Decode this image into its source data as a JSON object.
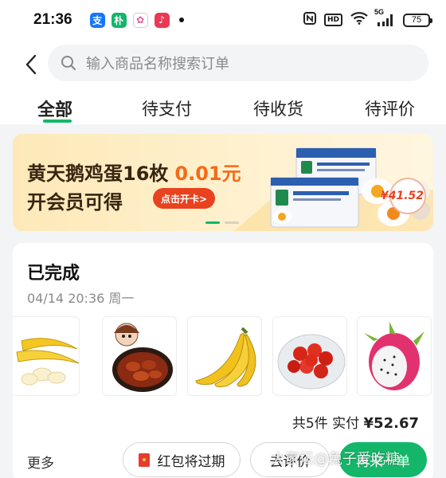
{
  "status_bar": {
    "time": "21:36",
    "battery": "75",
    "app_icons": [
      "支",
      "朴",
      "✿",
      "♪"
    ],
    "signal_label": "5G",
    "hd_label": "HD"
  },
  "search": {
    "placeholder": "输入商品名称搜索订单"
  },
  "tabs": [
    {
      "label": "全部",
      "active": true
    },
    {
      "label": "待支付",
      "active": false
    },
    {
      "label": "待收货",
      "active": false
    },
    {
      "label": "待评价",
      "active": false
    }
  ],
  "banner": {
    "line1": "黄天鹅鸡蛋16枚",
    "price": "0.01元",
    "line2": "开会员可得",
    "button": "点击开卡>",
    "price_tag": "¥41.52",
    "slide_count": 2,
    "active_slide": 0
  },
  "order": {
    "status": "已完成",
    "time": "04/14 20:36 周一",
    "products": [
      "banana-icon",
      "braised-meat-icon",
      "banana-bunch-icon",
      "cherry-tomato-icon",
      "dragon-fruit-icon"
    ],
    "summary_prefix": "共5件 实付",
    "amount": "¥52.67",
    "more_label": "更多",
    "buttons": {
      "red_packet": "红包将过期",
      "review": "去评价",
      "reorder": "再来一单"
    }
  },
  "watermark": "大家坛@兔子爱吃糖",
  "colors": {
    "accent": "#14b769",
    "price": "#f36b1a",
    "banner_button": "#e8421f"
  }
}
